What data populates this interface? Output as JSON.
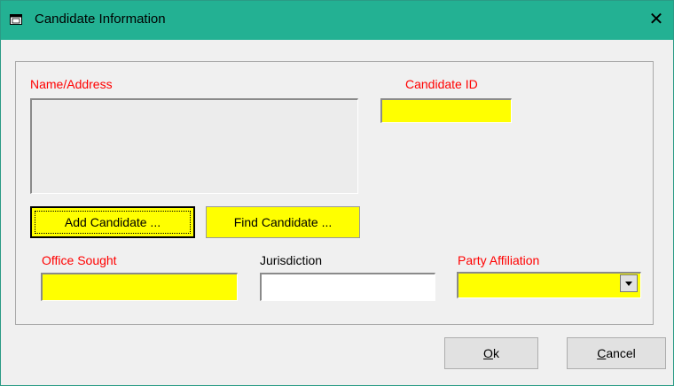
{
  "window": {
    "title": "Candidate Information",
    "accent": "#23b193"
  },
  "labels": {
    "name_address": "Name/Address",
    "candidate_id": "Candidate ID",
    "office_sought": "Office Sought",
    "jurisdiction": "Jurisdiction",
    "party_affiliation": "Party Affiliation"
  },
  "fields": {
    "name_address": "",
    "candidate_id": "",
    "office_sought": "",
    "jurisdiction": "",
    "party_affiliation": ""
  },
  "buttons": {
    "add_candidate": "Add Candidate ...",
    "find_candidate": "Find Candidate ...",
    "ok": {
      "mnemonic": "O",
      "rest": "k"
    },
    "cancel": {
      "mnemonic": "C",
      "rest": "ancel"
    }
  },
  "colors": {
    "required_label": "#ff0000",
    "required_field": "#ffff00"
  },
  "icons": {
    "title": "window-icon",
    "close": "close-icon",
    "dropdown": "chevron-down-icon"
  }
}
